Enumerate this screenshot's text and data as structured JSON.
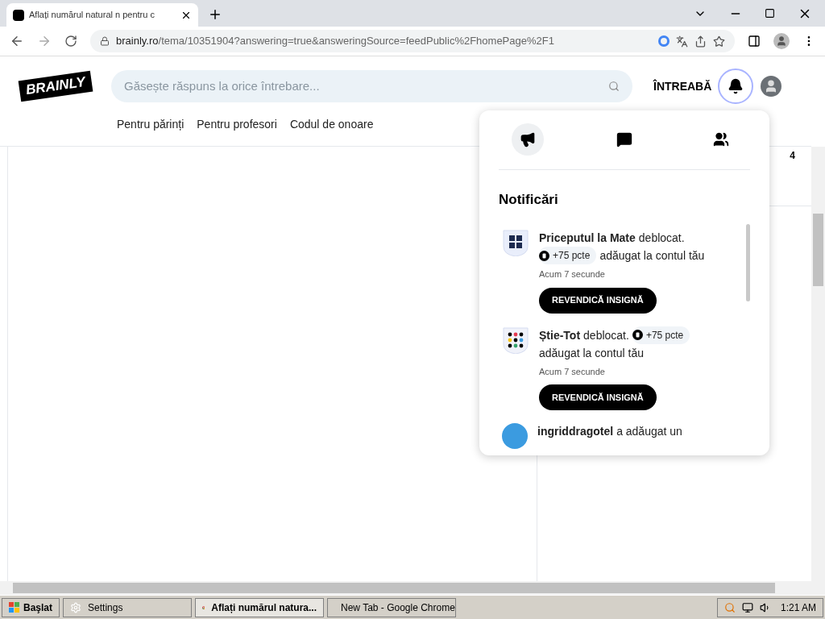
{
  "browser": {
    "tab_title": "Aflați numărul natural n pentru c",
    "url_host": "brainly.ro",
    "url_path": "/tema/10351904?answering=true&answeringSource=feedPublic%2FhomePage%2F1"
  },
  "header": {
    "logo": "BRAINLY",
    "search_placeholder": "Găsește răspuns la orice întrebare...",
    "ask": "ÎNTREABĂ",
    "nav": [
      "Pentru părinți",
      "Pentru profesori",
      "Codul de onoare"
    ]
  },
  "side_card": {
    "count": "4"
  },
  "panel": {
    "tabs": [
      {
        "kind": "megaphone",
        "selected": true
      },
      {
        "kind": "chat",
        "selected": false
      },
      {
        "kind": "people",
        "selected": false
      }
    ],
    "title": "Notificări",
    "items": [
      {
        "kind": "badge",
        "name": "Priceputul la Mate",
        "text": "deblocat.",
        "points": "+75 pcte",
        "suffix": "adăugat la contul tău",
        "time": "Acum 7 secunde",
        "button": "REVENDICĂ INSIGNĂ"
      },
      {
        "kind": "badge",
        "name": "Știe-Tot",
        "text": "deblocat.",
        "points": "+75 pcte",
        "suffix": "adăugat la contul tău",
        "time": "Acum 7 secunde",
        "button": "REVENDICĂ INSIGNĂ"
      },
      {
        "kind": "user",
        "name": "ingriddragotel",
        "text": "a adăugat un"
      }
    ]
  },
  "taskbar": {
    "start": "Başlat",
    "buttons": [
      {
        "label": "Settings",
        "selected": false,
        "kind": "settings"
      },
      {
        "label": "Aflați numărul natura...",
        "selected": true,
        "kind": "browser"
      },
      {
        "label": "New Tab - Google Chrome",
        "selected": false,
        "kind": "browser"
      }
    ],
    "clock": "1:21 AM"
  }
}
